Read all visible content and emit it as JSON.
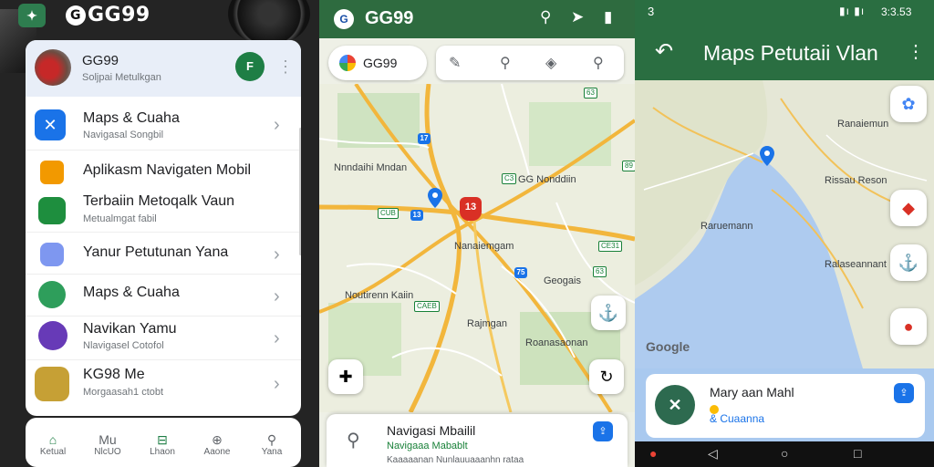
{
  "left_panel": {
    "brand": "GG99",
    "header": {
      "title": "GG99",
      "subtitle": "Soljpai Metulkgan"
    },
    "menu": [
      {
        "title": "Maps & Cuaha",
        "subtitle": "Navigasal Songbil",
        "color": "#1a73e8",
        "chevron": true
      },
      {
        "title": "Aplikasm Navigaten Mobil",
        "subtitle": "",
        "color": "#f29900",
        "chevron": false
      },
      {
        "title": "Terbaiin Metoqalk Vaun",
        "subtitle": "Metualmgat fabil",
        "color": "#1e8e3e",
        "chevron": false
      },
      {
        "title": "Yanur Petutunan Yana",
        "subtitle": "",
        "color": "#7e97f0",
        "chevron": true
      },
      {
        "title": "Maps & Cuaha",
        "subtitle": "",
        "color": "#2e9e5b",
        "chevron": true
      },
      {
        "title": "Navikan Yamu",
        "subtitle": "Nlavigasel Cotofol",
        "color": "#673ab7",
        "chevron": true
      },
      {
        "title": "KG98 Me",
        "subtitle": "Morgaasah1 ctobt",
        "color": "#c6a035",
        "chevron": true
      }
    ],
    "bottom_nav": [
      {
        "icon": "⌂",
        "label": "Ketual"
      },
      {
        "icon": "Mu",
        "label": "NlcUO"
      },
      {
        "icon": "⊟",
        "label": "Lhaon"
      },
      {
        "icon": "⊕",
        "label": "Aaone"
      },
      {
        "icon": "⚲",
        "label": "Yana"
      }
    ]
  },
  "middle_panel": {
    "title": "GG99",
    "search_text": "GG99",
    "map_labels": {
      "l1": "Nnndaihi Mndan",
      "l2": "GG Nonddiin",
      "l3": "Nanaiemgam",
      "l4": "Noutirenn Kaiin",
      "l5": "Geogais",
      "l6": "Rajmgan",
      "l7": "Roanasaonan"
    },
    "shields": {
      "s1": "17",
      "s2": "13",
      "s3": "75"
    },
    "green_shields": {
      "g1": "63",
      "g2": "CUB",
      "g3": "89",
      "g4": "C3",
      "g5": "CE31",
      "g6": "63",
      "g7": "CAEB"
    },
    "pin_label": "13",
    "card": {
      "title": "Navigasi Mbailil",
      "subtitle": "Navigaaa Mabablt",
      "detail": "Kaaaaanan Nunlauuaaanhn rataa"
    }
  },
  "right_panel": {
    "status_left": "3",
    "status_signal": "▮ı ▮ı",
    "status_time": "3:3.53",
    "title": "Maps Petutaii Vlan",
    "map_labels": {
      "m1": "Rissau Reson",
      "m2": "Ralaseannant",
      "m3": "Raruemann",
      "m4": "Ranaiemun"
    },
    "google": "Google",
    "card": {
      "title": "Mary aan Mahl",
      "subtitle": "& Cuaanna"
    }
  }
}
